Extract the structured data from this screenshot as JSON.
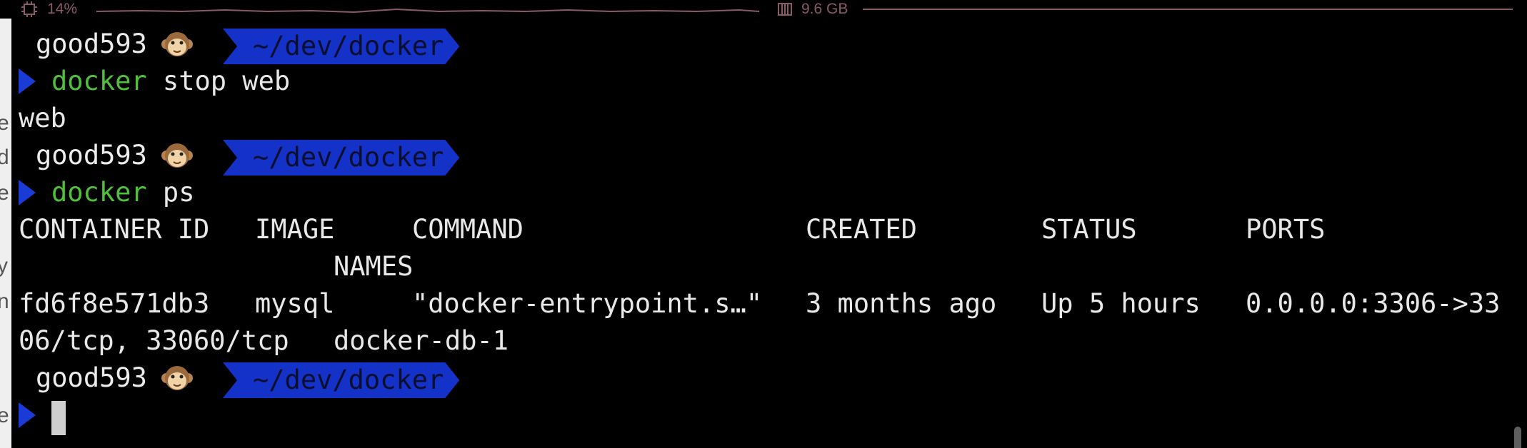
{
  "status_bar": {
    "cpu": {
      "icon": "cpu-chip-icon",
      "value": "14%"
    },
    "memory": {
      "icon": "memory-icon",
      "value": "9.6 GB"
    },
    "accent_color": "#8a5a6a"
  },
  "prompt": {
    "user": "good593",
    "emoji": "monkey-face-icon",
    "path": "~/dev/docker",
    "path_bg": "#1431c8"
  },
  "session": {
    "cmd1": {
      "verb": "docker",
      "args": " stop web"
    },
    "out1": "web",
    "cmd2": {
      "verb": "docker",
      "args": " ps"
    },
    "ps_headers": {
      "container_id": "CONTAINER ID",
      "image": "IMAGE",
      "command": "COMMAND",
      "created": "CREATED",
      "status": "STATUS",
      "ports": "PORTS",
      "names": "NAMES"
    },
    "ps_row": {
      "container_id": "fd6f8e571db3",
      "image": "mysql",
      "command": "\"docker-entrypoint.s…\"",
      "created": "3 months ago",
      "status": "Up 5 hours",
      "ports_part1": "0.0.0.0:3306->33",
      "ports_part2": "06/tcp, 33060/tcp",
      "names": "docker-db-1"
    }
  },
  "colors": {
    "command_verb": "#4fc13a",
    "chevron": "#1a3bd6",
    "text": "#e8e8e8"
  }
}
